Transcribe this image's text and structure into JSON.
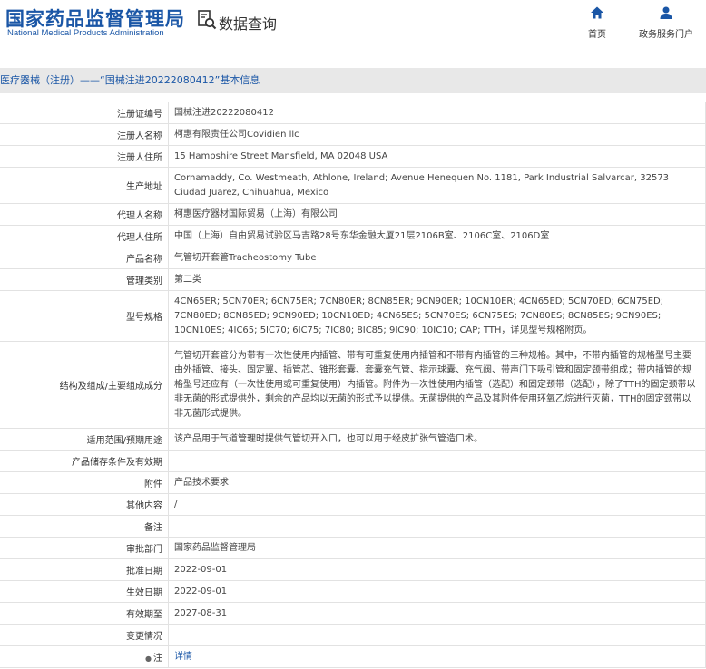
{
  "header": {
    "logo_cn": "国家药品监督管理局",
    "logo_en": "National Medical Products Administration",
    "query_title": "数据查询",
    "nav": [
      {
        "label": "首页",
        "icon": "home-icon"
      },
      {
        "label": "政务服务门户",
        "icon": "user-icon"
      }
    ]
  },
  "breadcrumb": "医疗器械（注册）——“国械注进20222080412”基本信息",
  "rows": [
    {
      "key": "注册证编号",
      "value": "国械注进20222080412"
    },
    {
      "key": "注册人名称",
      "value": "柯惠有限责任公司Covidien llc"
    },
    {
      "key": "注册人住所",
      "value": "15 Hampshire Street Mansfield, MA 02048 USA"
    },
    {
      "key": "生产地址",
      "value": "Cornamaddy, Co. Westmeath, Athlone, Ireland; Avenue Henequen No. 1181, Park Industrial Salvarcar, 32573 Ciudad Juarez, Chihuahua, Mexico"
    },
    {
      "key": "代理人名称",
      "value": "柯惠医疗器材国际贸易（上海）有限公司"
    },
    {
      "key": "代理人住所",
      "value": "中国（上海）自由贸易试验区马吉路28号东华金融大厦21层2106B室、2106C室、2106D室"
    },
    {
      "key": "产品名称",
      "value": "气管切开套管Tracheostomy Tube"
    },
    {
      "key": "管理类别",
      "value": "第二类"
    },
    {
      "key": "型号规格",
      "value": "4CN65ER; 5CN70ER; 6CN75ER; 7CN80ER; 8CN85ER; 9CN90ER; 10CN10ER; 4CN65ED; 5CN70ED; 6CN75ED; 7CN80ED; 8CN85ED; 9CN90ED; 10CN10ED; 4CN65ES; 5CN70ES; 6CN75ES; 7CN80ES; 8CN85ES; 9CN90ES; 10CN10ES; 4IC65; 5IC70; 6IC75; 7IC80; 8IC85; 9IC90; 10IC10; CAP; TTH，详见型号规格附页。"
    },
    {
      "key": "结构及组成/主要组成成分",
      "value": "气管切开套管分为带有一次性使用内插管、带有可重复使用内插管和不带有内插管的三种规格。其中，不带内插管的规格型号主要由外插管、接头、固定翼、插管芯、锥形套囊、套囊充气管、指示球囊、充气阀、带声门下吸引管和固定颈带组成；带内插管的规格型号还应有（一次性使用或可重复使用）内插管。附件为一次性使用内插管（选配）和固定颈带（选配），除了TTH的固定颈带以非无菌的形式提供外，剩余的产品均以无菌的形式予以提供。无菌提供的产品及其附件使用环氧乙烷进行灭菌，TTH的固定颈带以非无菌形式提供。"
    },
    {
      "key": "适用范围/预期用途",
      "value": "该产品用于气道管理时提供气管切开入口，也可以用于经皮扩张气管造口术。"
    },
    {
      "key": "产品储存条件及有效期",
      "value": ""
    },
    {
      "key": "附件",
      "value": "产品技术要求"
    },
    {
      "key": "其他内容",
      "value": "/"
    },
    {
      "key": "备注",
      "value": ""
    },
    {
      "key": "审批部门",
      "value": "国家药品监督管理局"
    },
    {
      "key": "批准日期",
      "value": "2022-09-01"
    },
    {
      "key": "生效日期",
      "value": "2022-09-01"
    },
    {
      "key": "有效期至",
      "value": "2027-08-31"
    },
    {
      "key": "变更情况",
      "value": ""
    }
  ],
  "note": {
    "key": "注",
    "value": "详情"
  }
}
